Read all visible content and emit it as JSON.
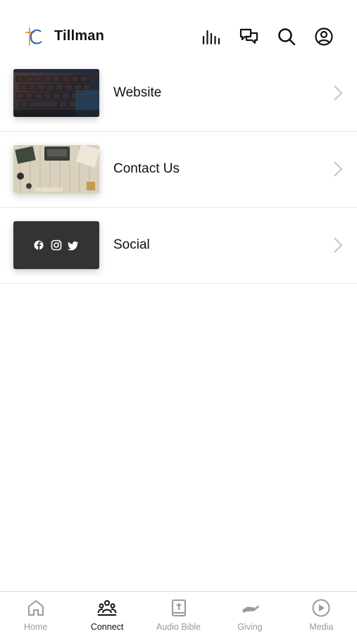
{
  "app": {
    "title": "Tillman",
    "logo_text": "tC"
  },
  "header_icons": [
    "audio-bars-icon",
    "chat-icon",
    "search-icon",
    "profile-icon"
  ],
  "items": [
    {
      "label": "Website",
      "image": "keyboard-photo"
    },
    {
      "label": "Contact Us",
      "image": "desk-typewriter-photo"
    },
    {
      "label": "Social",
      "image": "social-icons-tile"
    }
  ],
  "tabs": [
    {
      "label": "Home",
      "icon": "home-icon",
      "active": false
    },
    {
      "label": "Connect",
      "icon": "people-icon",
      "active": true
    },
    {
      "label": "Audio Bible",
      "icon": "bible-icon",
      "active": false
    },
    {
      "label": "Giving",
      "icon": "giving-hand-icon",
      "active": false
    },
    {
      "label": "Media",
      "icon": "play-circle-icon",
      "active": false
    }
  ],
  "colors": {
    "active": "#111111",
    "inactive": "#9a9a9a",
    "logo_orange": "#e08a2c",
    "logo_blue": "#2f5fa8",
    "divider": "#e6e6e6"
  }
}
